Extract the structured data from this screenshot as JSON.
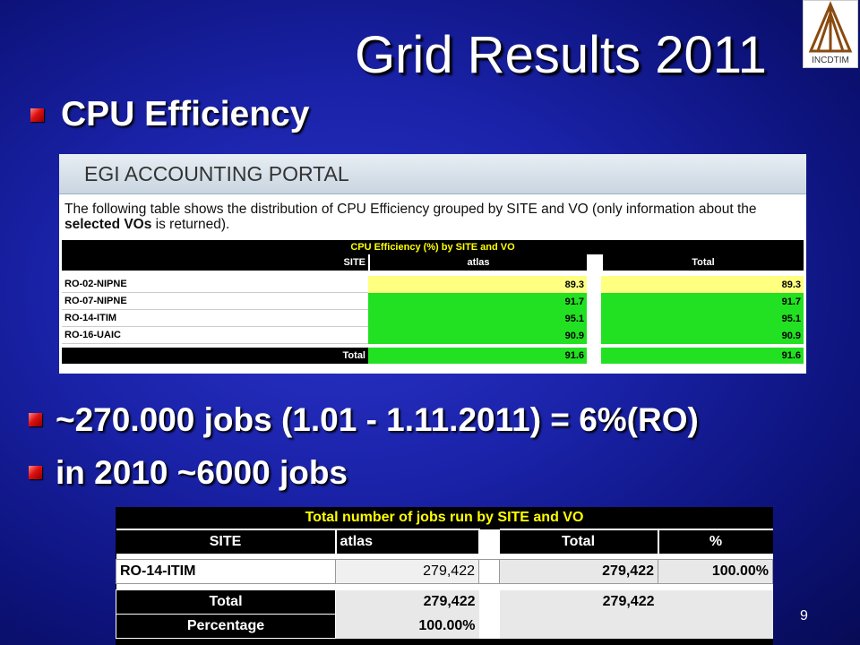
{
  "slide": {
    "title": "Grid Results 2011",
    "logo_text": "INCDTIM",
    "bullets": [
      "CPU Efficiency",
      "~270.000 jobs (1.01 - 1.11.2011) = 6%(RO)",
      "in 2010 ~6000 jobs"
    ],
    "page_number": "9"
  },
  "portal": {
    "header": "EGI ACCOUNTING PORTAL",
    "desc_part1": "The following table shows the distribution of CPU Efficiency grouped by SITE and VO (only information about the ",
    "desc_bold": "selected VOs",
    "desc_part2": " is returned).",
    "table_title": "CPU Efficiency (%) by SITE and VO",
    "col_site": "SITE",
    "col_atlas": "atlas",
    "col_total": "Total",
    "rows": [
      {
        "site": "RO-02-NIPNE",
        "atlas": "89.3",
        "total": "89.3"
      },
      {
        "site": "RO-07-NIPNE",
        "atlas": "91.7",
        "total": "91.7"
      },
      {
        "site": "RO-14-ITIM",
        "atlas": "95.1",
        "total": "95.1"
      },
      {
        "site": "RO-16-UAIC",
        "atlas": "90.9",
        "total": "90.9"
      }
    ],
    "total_label": "Total",
    "total_atlas": "91.6",
    "total_total": "91.6"
  },
  "jobs": {
    "title": "Total number of jobs run by SITE and VO",
    "col_site": "SITE",
    "col_atlas": "atlas",
    "col_total": "Total",
    "col_pct": "%",
    "row_site": "RO-14-ITIM",
    "row_atlas": "279,422",
    "row_total": "279,422",
    "row_pct": "100.00%",
    "total_label": "Total",
    "total_atlas": "279,422",
    "total_total": "279,422",
    "pct_label": "Percentage",
    "pct_atlas": "100.00%"
  }
}
